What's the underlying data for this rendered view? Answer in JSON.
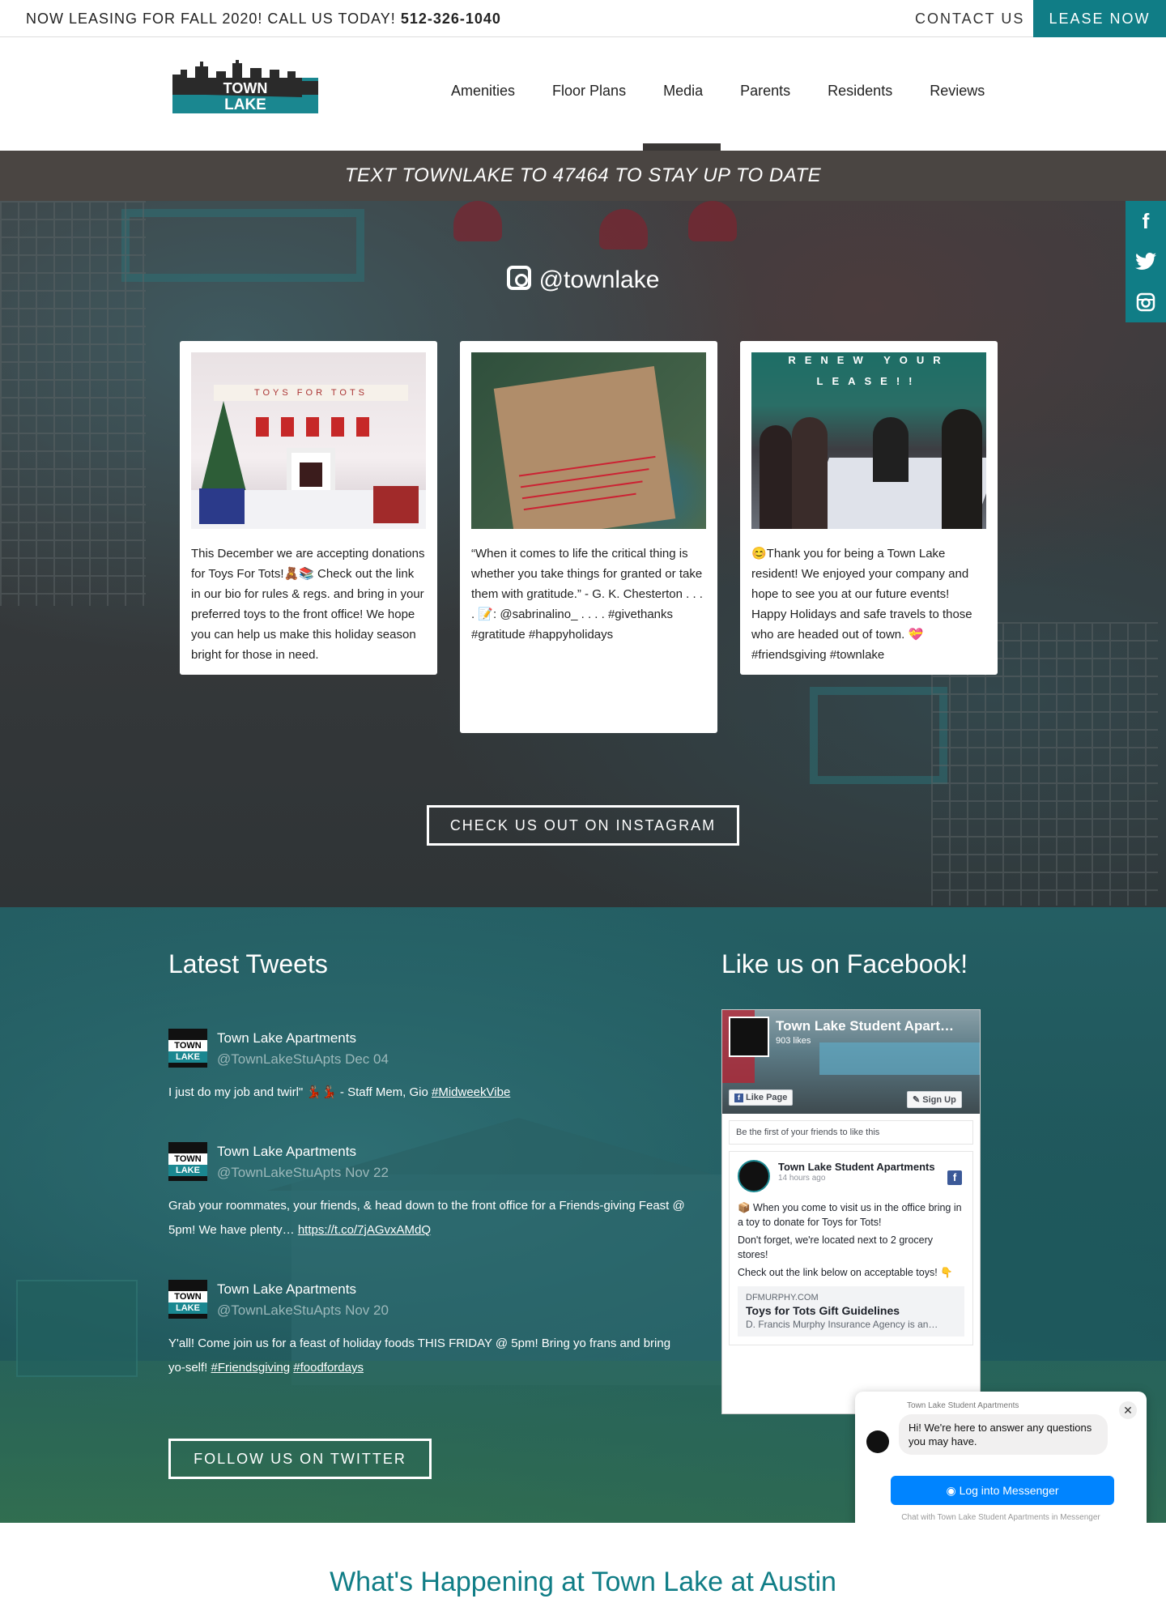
{
  "topbar": {
    "leasing_text": "NOW LEASING FOR FALL 2020! CALL US TODAY!",
    "phone": "512-326-1040",
    "contact_label": "CONTACT US",
    "lease_label": "LEASE NOW"
  },
  "logo": {
    "top_text": "TOWN",
    "bottom_text": "LAKE"
  },
  "nav": {
    "items": [
      {
        "label": "Amenities"
      },
      {
        "label": "Floor Plans"
      },
      {
        "label": "Media"
      },
      {
        "label": "Parents"
      },
      {
        "label": "Residents"
      },
      {
        "label": "Reviews"
      }
    ],
    "active": "Media"
  },
  "text_band": "TEXT TOWNLAKE TO 47464 TO STAY UP TO DATE",
  "social_icons": [
    "facebook-icon",
    "twitter-icon",
    "instagram-icon"
  ],
  "instagram": {
    "handle": "@townlake",
    "posts": [
      {
        "caption": "This December we are accepting donations for Toys For Tots!🧸📚 Check out the link in our bio for rules & regs. and bring in your preferred toys to the front office! We hope you can help us make this holiday season bright for those in need.",
        "sign_text": "TOYS FOR TOTS"
      },
      {
        "caption": "“When it comes to life the critical thing is whether you take things for granted or take them with gratitude.” - G. K. Chesterton . . . . 📝: @sabrinalino_ . . . . #givethanks #gratitude #happyholidays"
      },
      {
        "caption": "😊Thank you for being a Town Lake resident! We enjoyed your company and hope to see you at our future events! Happy Holidays and safe travels to those who are headed out of town. 💝 #friendsgiving #townlake",
        "sign_top": "RENEW YOUR",
        "sign_bottom": "LEASE!!"
      }
    ],
    "button_label": "CHECK US OUT ON INSTAGRAM"
  },
  "twitter": {
    "title": "Latest Tweets",
    "tweets": [
      {
        "name": "Town Lake Apartments",
        "handle_date": "@TownLakeStuApts Dec 04",
        "text": "I just do my job and twirl\" 💃🏽💃🏽 - Staff Mem, Gio ",
        "link": "#MidweekVibe"
      },
      {
        "name": "Town Lake Apartments",
        "handle_date": "@TownLakeStuApts Nov 22",
        "text": "Grab your roommates, your friends, & head down to the front office for a Friends-giving Feast @ 5pm! We have plenty… ",
        "link": "https://t.co/7jAGvxAMdQ"
      },
      {
        "name": "Town Lake Apartments",
        "handle_date": "@TownLakeStuApts Nov 20",
        "text": "Y'all! Come join us for a feast of holiday foods THIS FRIDAY @ 5pm! Bring yo frans and bring yo-self! ",
        "link": "#Friendsgiving",
        "link2": "#foodfordays"
      }
    ],
    "avatar_top": "TOWN",
    "avatar_bottom": "LAKE",
    "button_label": "FOLLOW US ON TWITTER"
  },
  "facebook": {
    "title": "Like us on Facebook!",
    "page_name": "Town Lake Student Apart…",
    "likes": "903 likes",
    "like_button": "Like Page",
    "signup_button": "Sign Up",
    "friends_text": "Be the first of your friends to like this",
    "post_author": "Town Lake Student Apartments",
    "post_time": "14 hours ago",
    "post_lines": [
      "📦 When you come to visit us in the office bring in a toy to donate for Toys for Tots!",
      "Don't forget, we're located next to 2 grocery stores!",
      "Check out the link below on acceptable toys! 👇"
    ],
    "link_domain": "DFMURPHY.COM",
    "link_title": "Toys for Tots Gift Guidelines",
    "link_sub": "D. Francis Murphy Insurance Agency is an…"
  },
  "messenger": {
    "header": "Town Lake Student Apartments",
    "greeting": "Hi! We're here to answer any questions you may have.",
    "button": "Log into Messenger",
    "footer": "Chat with Town Lake Student Apartments in Messenger"
  },
  "happening_title": "What's Happening at Town Lake at Austin",
  "colors": {
    "brand_teal": "#107d86",
    "dark_band": "#4a4542",
    "messenger_blue": "#0084ff"
  }
}
